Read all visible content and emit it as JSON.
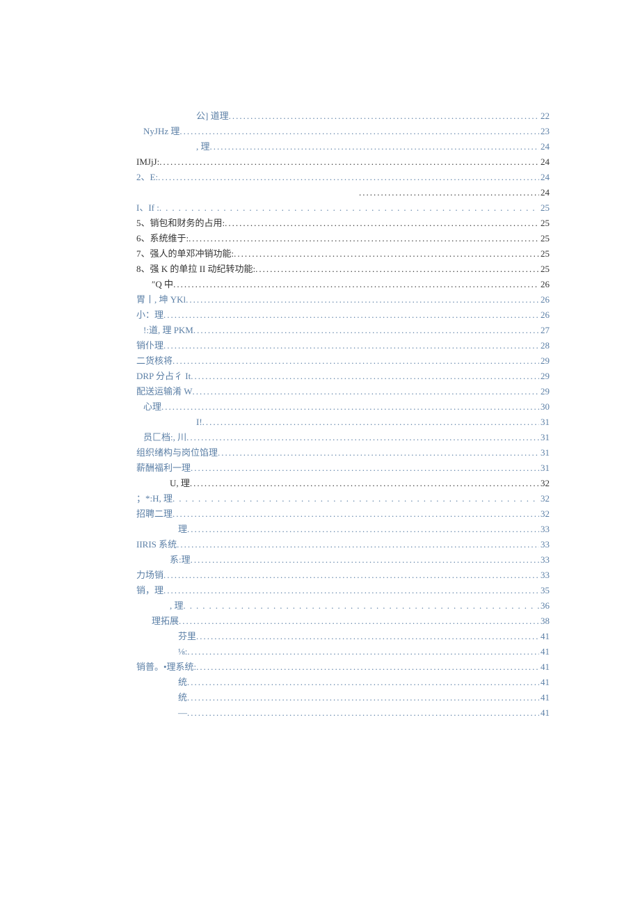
{
  "toc": [
    {
      "label": "公] 道理",
      "page": "22",
      "indent": "ind5",
      "cls": "",
      "leader": ""
    },
    {
      "label": "NyJHz 理",
      "page": "23",
      "indent": "ind1",
      "cls": "",
      "leader": ""
    },
    {
      "label": ", 理",
      "page": "24",
      "indent": "ind5",
      "cls": "",
      "leader": ""
    },
    {
      "label": "IMJjJ:",
      "page": "24",
      "indent": "ind0",
      "cls": "reg",
      "leader": ""
    },
    {
      "label": "2、E:",
      "page": "24",
      "indent": "ind0",
      "cls": "",
      "leader": ""
    },
    {
      "label": "",
      "page": "24",
      "indent": "ind6",
      "cls": "reg",
      "leader": ""
    },
    {
      "label": "I、If           :",
      "page": "25",
      "indent": "ind0",
      "cls": "",
      "leader": "sparse"
    },
    {
      "label": "5、销包和财务的占用:",
      "page": "25",
      "indent": "ind0",
      "cls": "reg",
      "leader": ""
    },
    {
      "label": "6、系统维于:",
      "page": "25",
      "indent": "ind0",
      "cls": "reg",
      "leader": ""
    },
    {
      "label": "7、强人的单邓冲销功能:",
      "page": "25",
      "indent": "ind0",
      "cls": "reg",
      "leader": ""
    },
    {
      "label": "8、强 K 的单拉 II 动纪转功能:",
      "page": "25",
      "indent": "ind0",
      "cls": "reg",
      "leader": ""
    },
    {
      "label": "″Q 中",
      "page": "26",
      "indent": "ind2",
      "cls": "reg",
      "leader": ""
    },
    {
      "label": "胃丨, 坤 YKl",
      "page": "26",
      "indent": "ind0",
      "cls": "",
      "leader": ""
    },
    {
      "label": "小：理",
      "page": "26",
      "indent": "ind0",
      "cls": "",
      "leader": ""
    },
    {
      "label": "!:道, 理 PKM",
      "page": "27",
      "indent": "ind1",
      "cls": "",
      "leader": ""
    },
    {
      "label": "销仆理",
      "page": "28",
      "indent": "ind0",
      "cls": "",
      "leader": ""
    },
    {
      "label": "二货核将",
      "page": "29",
      "indent": "ind0",
      "cls": "",
      "leader": ""
    },
    {
      "label": "DRP 分占彳 It",
      "page": "29",
      "indent": "ind0",
      "cls": "",
      "leader": ""
    },
    {
      "label": "配送运输淆 W",
      "page": "29",
      "indent": "ind0",
      "cls": "",
      "leader": ""
    },
    {
      "label": "心理",
      "page": "30",
      "indent": "ind1",
      "cls": "",
      "leader": ""
    },
    {
      "label": "I!",
      "page": "31",
      "indent": "ind5",
      "cls": "",
      "leader": ""
    },
    {
      "label": "员匚档:, 川",
      "page": "31",
      "indent": "ind1",
      "cls": "",
      "leader": ""
    },
    {
      "label": "组织绪构与岗位馅理",
      "page": "31",
      "indent": "ind0",
      "cls": "",
      "leader": ""
    },
    {
      "label": "薪酬福利一理",
      "page": "31",
      "indent": "ind0",
      "cls": "",
      "leader": ""
    },
    {
      "label": "U, 理",
      "page": "32",
      "indent": "ind3",
      "cls": "reg",
      "leader": ""
    },
    {
      "label": "；*:H, 理",
      "page": "32",
      "indent": "ind0",
      "cls": "",
      "leader": "sparse"
    },
    {
      "label": "招聘二理",
      "page": "32",
      "indent": "ind0",
      "cls": "",
      "leader": ""
    },
    {
      "label": "理",
      "page": "33",
      "indent": "ind4",
      "cls": "",
      "leader": ""
    },
    {
      "label": "IIRIS 系统",
      "page": "33",
      "indent": "ind0",
      "cls": "",
      "leader": ""
    },
    {
      "label": "系:理",
      "page": "33",
      "indent": "ind3",
      "cls": "",
      "leader": ""
    },
    {
      "label": "力场销",
      "page": "33",
      "indent": "ind0",
      "cls": "",
      "leader": ""
    },
    {
      "label": "销，理",
      "page": "35",
      "indent": "ind0",
      "cls": "",
      "leader": ""
    },
    {
      "label": ", 理",
      "page": "36",
      "indent": "ind3",
      "cls": "",
      "leader": "sparse"
    },
    {
      "label": "理拓展",
      "page": "38",
      "indent": "ind2",
      "cls": "",
      "leader": ""
    },
    {
      "label": "芬里",
      "page": "41",
      "indent": "ind4",
      "cls": "",
      "leader": ""
    },
    {
      "label": "⅛:",
      "page": "41",
      "indent": "ind4",
      "cls": "",
      "leader": ""
    },
    {
      "label": "销普。•理系统:",
      "page": "41",
      "indent": "ind0",
      "cls": "",
      "leader": ""
    },
    {
      "label": "统",
      "page": "41",
      "indent": "ind4",
      "cls": "",
      "leader": ""
    },
    {
      "label": "统",
      "page": "41",
      "indent": "ind4",
      "cls": "",
      "leader": ""
    },
    {
      "label": "—",
      "page": "41",
      "indent": "ind4",
      "cls": "",
      "leader": ""
    }
  ]
}
